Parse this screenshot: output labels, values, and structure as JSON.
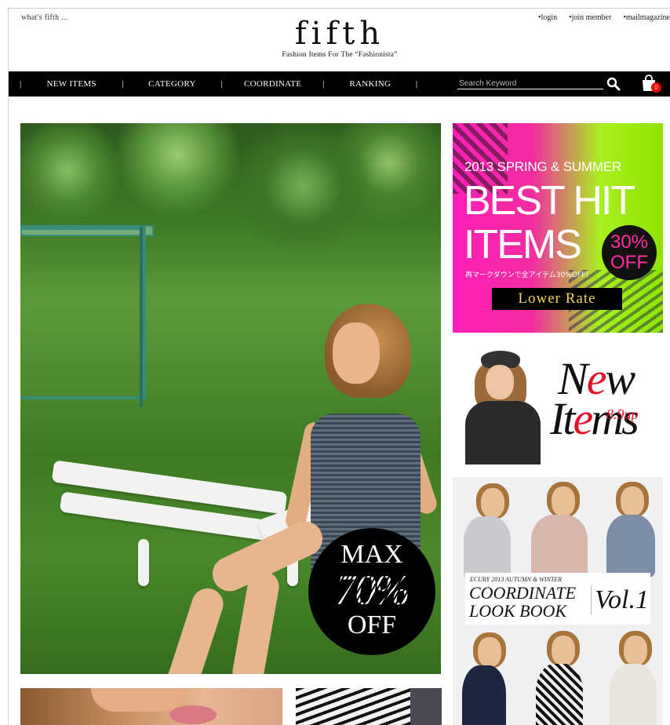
{
  "header": {
    "tagline": "what's fifth ...",
    "logo": "fifth",
    "subtitle": "Fashion Items For The “Fashionista”",
    "links": [
      "•login",
      "•join member",
      "•mailmagazine"
    ]
  },
  "nav": {
    "items": [
      "NEW ITEMS",
      "CATEGORY",
      "COORDINATE",
      "RANKING"
    ],
    "separator": "|",
    "search_placeholder": "Search Keyword",
    "cart_count": "0"
  },
  "hero": {
    "line1": "MAX",
    "line2": "70%",
    "line3": "OFF"
  },
  "banner_sale": {
    "season": "2013 SPRING & SUMMER",
    "headline1": "BEST HIT",
    "headline2": "ITEMS",
    "discount_value": "30%",
    "discount_word": "OFF",
    "japanese": "再マークダウンで全アイテム30%OFF！",
    "cta": "Lower Rate"
  },
  "banner_new": {
    "word1_a": "N",
    "word1_b": "e",
    "word1_c": "w",
    "word2_a": "It",
    "word2_b": "e",
    "word2_c": "ms",
    "date": "8.9up"
  },
  "banner_lookbook": {
    "eyebrow": "ECURY 2013 AUTUMN & WINTER",
    "line1": "COORDINATE",
    "line2": "LOOK BOOK",
    "volume": "Vol.1"
  },
  "colors": {
    "nav_bg": "#000000",
    "banner_pink": "#ff1fb8",
    "banner_green": "#a8f020",
    "accent_red": "#e2142c",
    "cta_gold": "#f3d25a"
  }
}
